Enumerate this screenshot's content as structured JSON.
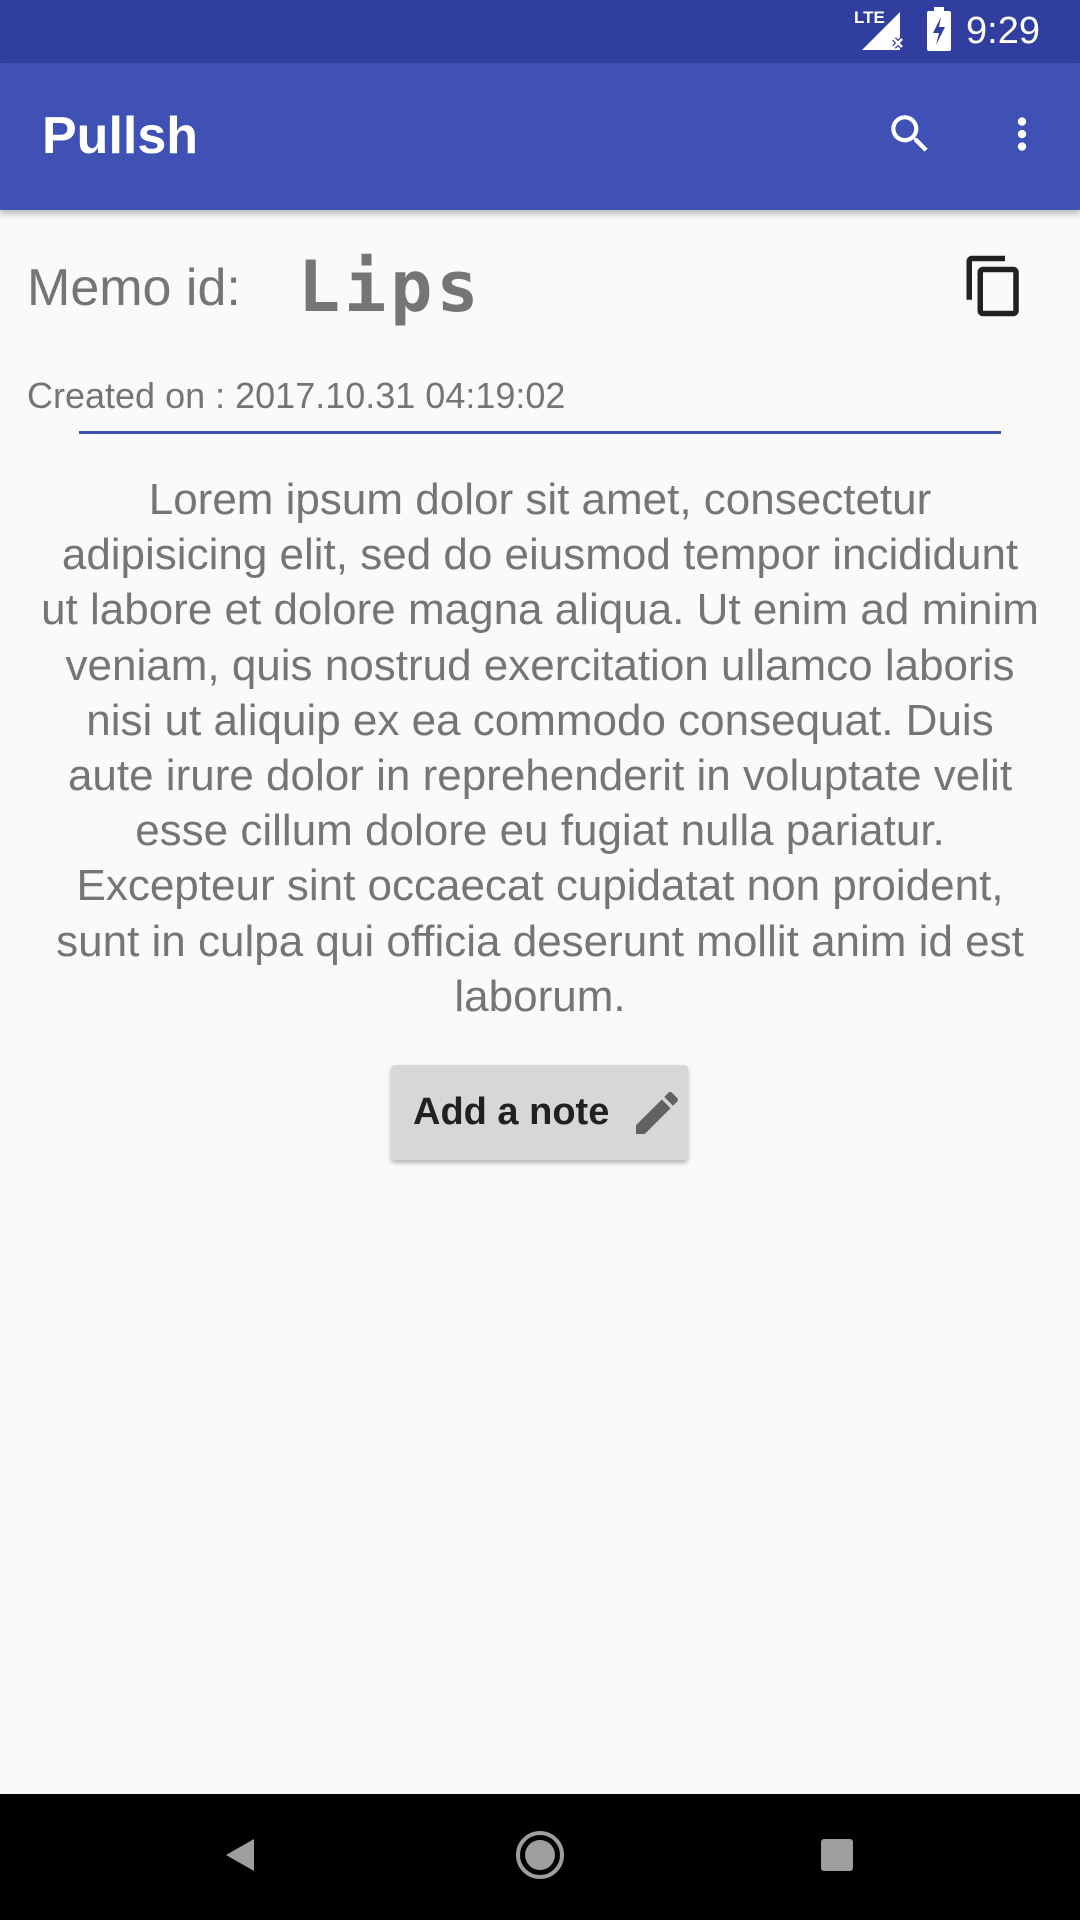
{
  "status_bar": {
    "network": "LTE",
    "time": "9:29",
    "icons": [
      "signal-icon",
      "battery-charging-icon"
    ]
  },
  "app_bar": {
    "title": "Pullsh",
    "icons": [
      "search-icon",
      "more-vert-icon"
    ]
  },
  "memo": {
    "id_label": "Memo id:",
    "id_value": "Lips",
    "created_on": "Created on : 2017.10.31 04:19:02",
    "body": "Lorem ipsum dolor sit amet, consectetur adipisicing elit, sed do eiusmod tempor incididunt ut labore et dolore magna aliqua. Ut enim ad minim veniam, quis nostrud exercitation ullamco laboris nisi ut aliquip ex ea commodo consequat. Duis aute irure dolor in reprehenderit in voluptate velit esse cillum dolore eu fugiat nulla pariatur. Excepteur sint occaecat cupidatat non proident, sunt in culpa qui officia deserunt mollit anim id est laborum.",
    "copy_icon": "copy-icon"
  },
  "add_note_button": {
    "label": "Add a note",
    "icon": "pencil-icon"
  },
  "nav_bar": {
    "icons": [
      "back-icon",
      "home-icon",
      "recents-icon"
    ]
  },
  "colors": {
    "primary": "#3f51b5",
    "primary_dark": "#303f9f",
    "text_secondary": "#757575",
    "button_bg": "#d6d7d7",
    "background": "#fafafa"
  }
}
